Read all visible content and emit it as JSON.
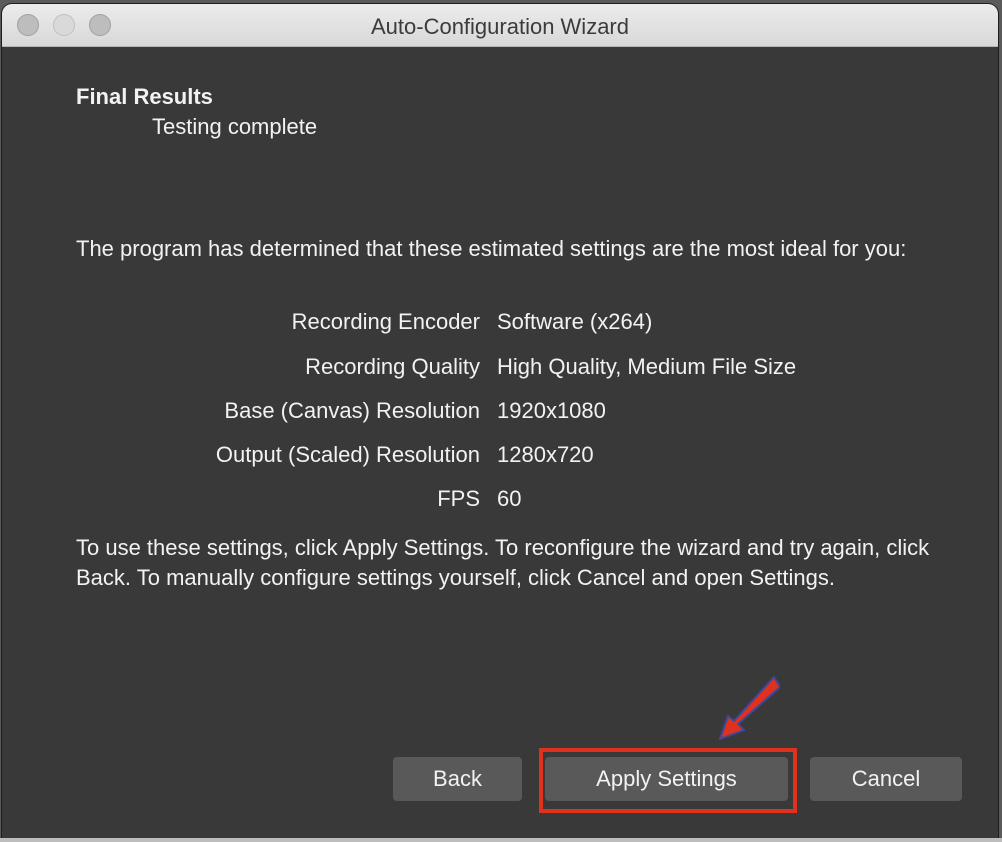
{
  "window": {
    "title": "Auto-Configuration Wizard"
  },
  "page": {
    "heading": "Final Results",
    "subheading": "Testing complete",
    "intro": "The program has determined that these estimated settings are the most ideal for you:",
    "settings": [
      {
        "label": "Recording Encoder",
        "value": "Software (x264)"
      },
      {
        "label": "Recording Quality",
        "value": "High Quality, Medium File Size"
      },
      {
        "label": "Base (Canvas) Resolution",
        "value": "1920x1080"
      },
      {
        "label": "Output (Scaled) Resolution",
        "value": "1280x720"
      },
      {
        "label": "FPS",
        "value": "60"
      }
    ],
    "instructions": "To use these settings, click Apply Settings. To reconfigure the wizard and try again, click Back. To manually configure settings yourself, click Cancel and open Settings."
  },
  "buttons": {
    "back": "Back",
    "apply": "Apply Settings",
    "cancel": "Cancel"
  },
  "colors": {
    "background": "#393939",
    "text": "#f2f2f2",
    "button": "#595959",
    "highlight": "#e0301e"
  },
  "icons": {
    "annotation": "red-arrow-icon"
  }
}
